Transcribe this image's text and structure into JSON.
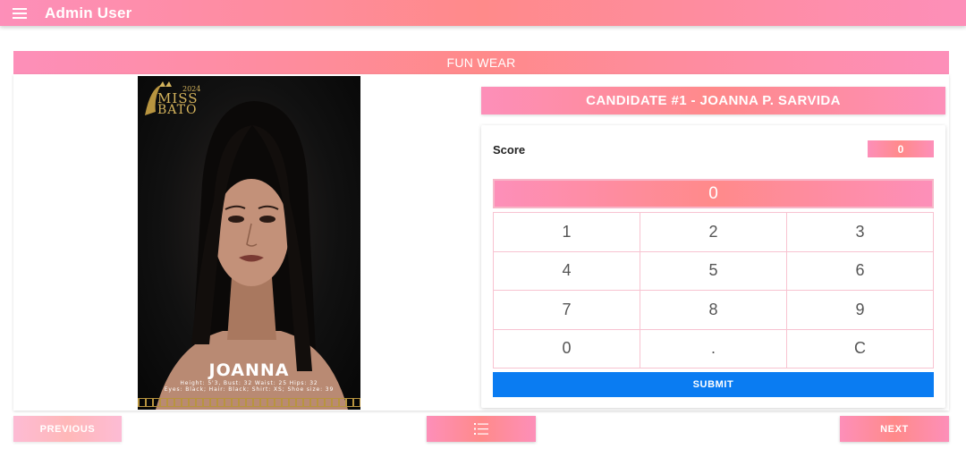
{
  "appbar": {
    "title": "Admin User",
    "menu_icon": "menu-icon"
  },
  "category": {
    "title": "FUN WEAR"
  },
  "portrait": {
    "logo_year": "2024",
    "logo_line1": "MISS",
    "logo_line2": "BATO",
    "name": "JOANNA",
    "stats_line1": "Height: 5'3, Bust: 32 Waist: 25 Hips: 32",
    "stats_line2": "Eyes: Black; Hair: Black; Shirt: XS; Shoe size: 39"
  },
  "candidate": {
    "title": "CANDIDATE #1 - JOANNA P. SARVIDA"
  },
  "scoring": {
    "score_label": "Score",
    "score_value": "0",
    "display_value": "0",
    "keys": [
      "1",
      "2",
      "3",
      "4",
      "5",
      "6",
      "7",
      "8",
      "9",
      "0",
      ".",
      "C"
    ],
    "submit_label": "SUBMIT"
  },
  "nav": {
    "previous_label": "PREVIOUS",
    "list_icon": "list-icon",
    "next_label": "NEXT"
  },
  "colors": {
    "accent_gradient_start": "#fd8fb9",
    "accent_gradient_mid": "#ff8a8a",
    "submit_blue": "#0a7cf2"
  }
}
